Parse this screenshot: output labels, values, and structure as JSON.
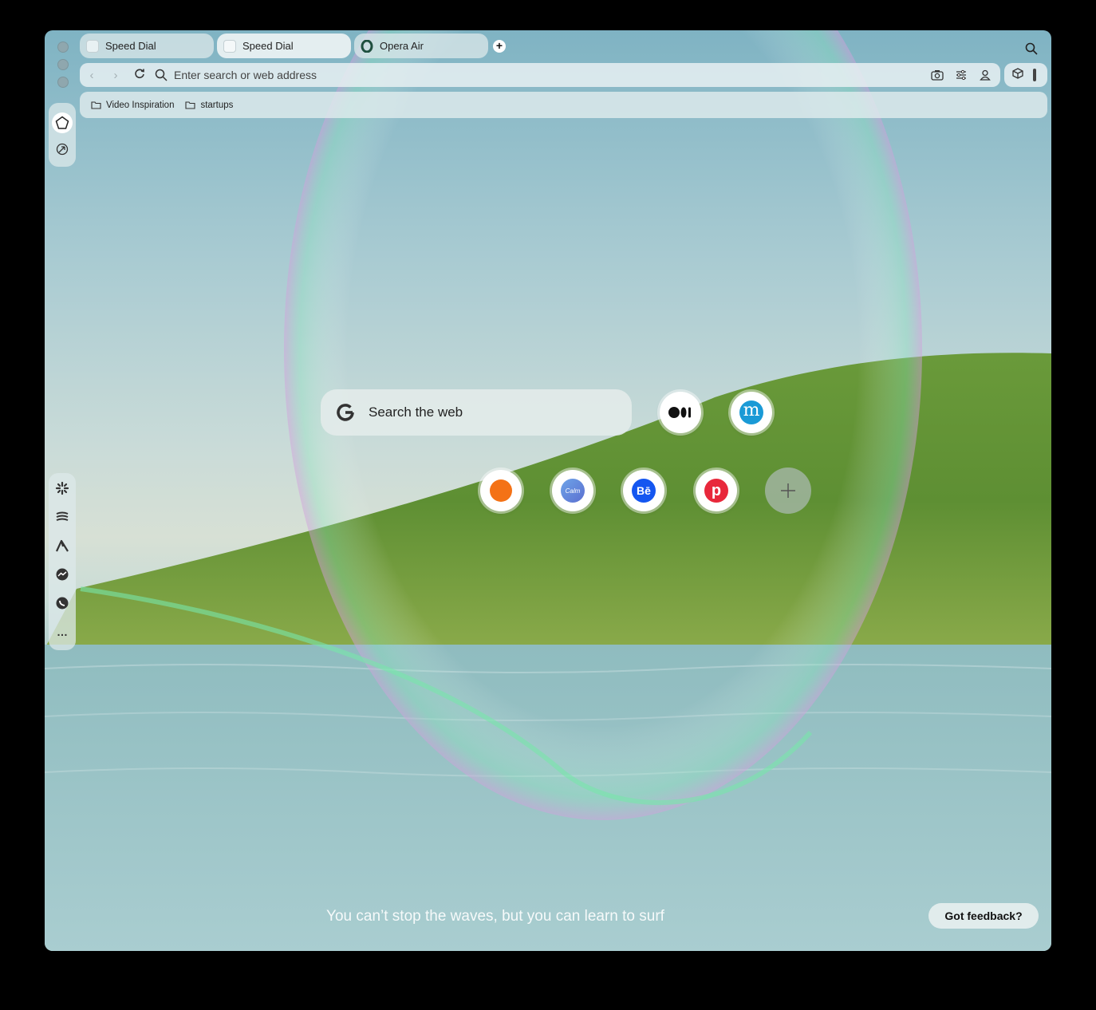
{
  "tabs": [
    {
      "label": "Speed Dial",
      "icon": "speed-dial-icon"
    },
    {
      "label": "Speed Dial",
      "icon": "speed-dial-icon"
    },
    {
      "label": "Opera Air",
      "icon": "opera-icon"
    }
  ],
  "address_bar": {
    "placeholder": "Enter search or web address"
  },
  "bookmarks": [
    {
      "label": "Video Inspiration",
      "icon": "folder-icon"
    },
    {
      "label": "startups",
      "icon": "folder-icon"
    }
  ],
  "search": {
    "placeholder": "Search the web",
    "engine_icon": "google-icon"
  },
  "speed_dials": {
    "row1": [
      {
        "name": "medium-dial",
        "glyph": "●●|"
      },
      {
        "name": "m-dial",
        "glyph": "m"
      }
    ],
    "row2": [
      {
        "name": "orange-dial",
        "glyph": ""
      },
      {
        "name": "calm-dial",
        "glyph": "Calm"
      },
      {
        "name": "behance-dial",
        "glyph": "Bē"
      },
      {
        "name": "p-dial",
        "glyph": "p"
      },
      {
        "name": "add-dial",
        "glyph": "+"
      }
    ]
  },
  "quote": "You can’t stop the waves, but you can learn to surf",
  "feedback_button": "Got feedback?",
  "colors": {
    "accent_blue": "#1a9ad6",
    "behance_blue": "#1456f0",
    "orange": "#f47216",
    "red": "#e8283b",
    "calm_blue": "#5b7fd6"
  }
}
